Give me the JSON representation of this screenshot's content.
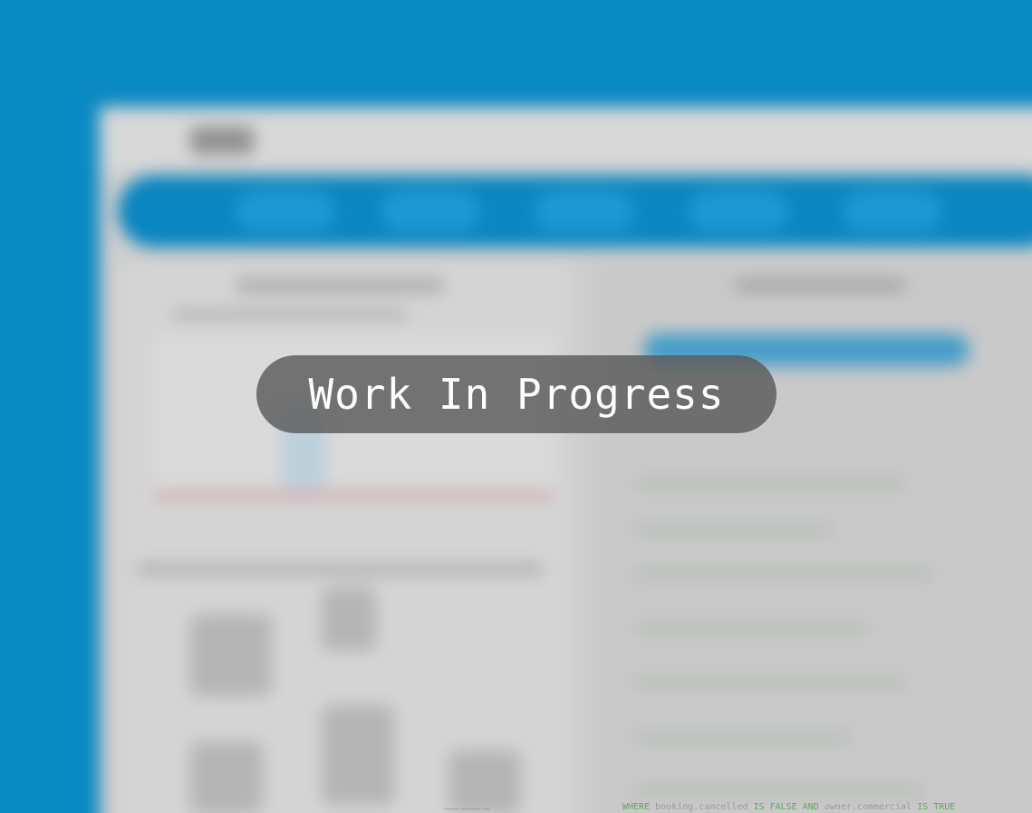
{
  "overlay": {
    "message": "Work In Progress"
  },
  "sql_snippet": {
    "kw_where": "WHERE",
    "expr1": "booking.cancelled",
    "kw_is_false": "IS FALSE",
    "kw_and": "AND",
    "expr2": "owner.commercial",
    "kw_is_true": "IS TRUE"
  },
  "colors": {
    "background": "#0a8ac3",
    "nav_blue": "#0a86c0",
    "badge": "#5a5a5a",
    "sql_keyword": "#5fa85f"
  }
}
